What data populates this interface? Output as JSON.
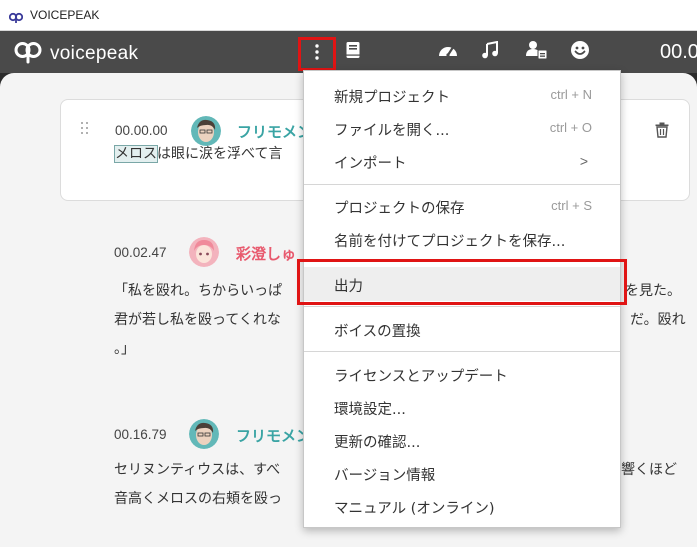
{
  "window": {
    "title": "VOICEPEAK"
  },
  "header": {
    "logo_text": "voicepeak",
    "time_readout": "00.0",
    "icons": [
      "kebab-menu-icon",
      "book-icon",
      "speed-gauge-icon",
      "music-note-icon",
      "user-dict-icon",
      "emotion-smiley-icon"
    ]
  },
  "lines": [
    {
      "time": "00.00.00",
      "speaker": "フリモメン",
      "speaker_color": "#3aa4a4",
      "highlight": "メロス",
      "text_lines": [
        "は眼に涙を浮べて言"
      ]
    },
    {
      "time": "00.02.47",
      "speaker": "彩澄しゅ",
      "speaker_color": "#e85a6e",
      "text_lines": [
        "「私を殴れ。ちからいっぱ",
        "君が若し私を殴ってくれな",
        "。」"
      ],
      "right_fragments": [
        "を見た。",
        "だ。殴れ"
      ]
    },
    {
      "time": "00.16.79",
      "speaker": "フリモメン",
      "speaker_color": "#3aa4a4",
      "text_lines": [
        "セリヌンティウスは、すべ",
        "音高くメロスの右頬を殴っ"
      ],
      "right_fragments": [
        "響くほど"
      ]
    }
  ],
  "menu": {
    "items": [
      {
        "label": "新規プロジェクト",
        "shortcut": "ctrl + N"
      },
      {
        "label": "ファイルを開く...",
        "shortcut": "ctrl + O"
      },
      {
        "label": "インポート",
        "shortcut": ">"
      },
      {
        "label": "プロジェクトの保存",
        "shortcut": "ctrl + S"
      },
      {
        "label": "名前を付けてプロジェクトを保存...",
        "shortcut": ""
      },
      {
        "label": "出力",
        "shortcut": ""
      },
      {
        "label": "ボイスの置換",
        "shortcut": ""
      },
      {
        "label": "ライセンスとアップデート",
        "shortcut": ""
      },
      {
        "label": "環境設定...",
        "shortcut": ""
      },
      {
        "label": "更新の確認...",
        "shortcut": ""
      },
      {
        "label": "バージョン情報",
        "shortcut": ""
      },
      {
        "label": "マニュアル (オンライン)",
        "shortcut": ""
      }
    ]
  },
  "colors": {
    "highlight_red": "#e01414",
    "accent_teal": "#3aa4a4",
    "accent_pink": "#e85a6e"
  }
}
